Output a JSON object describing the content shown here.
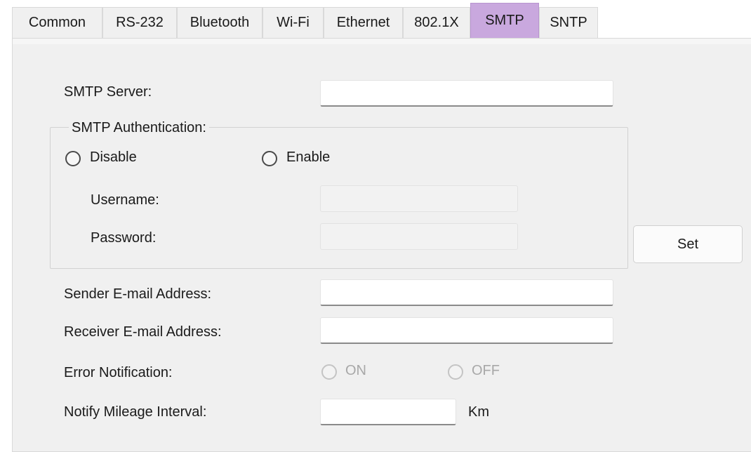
{
  "tabs": [
    "Common",
    "RS-232",
    "Bluetooth",
    "Wi-Fi",
    "Ethernet",
    "802.1X",
    "SMTP",
    "SNTP"
  ],
  "active_tab": "SMTP",
  "colors": {
    "active_tab": "#c9a8de",
    "panel_bg": "#f0f0f0",
    "disabled_text": "#a8a8a8"
  },
  "form": {
    "smtp_server": {
      "label": "SMTP Server:",
      "value": ""
    },
    "auth": {
      "title": "SMTP Authentication:",
      "disable_label": "Disable",
      "enable_label": "Enable",
      "selected": "none",
      "username": {
        "label": "Username:",
        "value": ""
      },
      "password": {
        "label": "Password:",
        "value": ""
      }
    },
    "sender": {
      "label": "Sender E-mail Address:",
      "value": ""
    },
    "receiver": {
      "label": "Receiver E-mail Address:",
      "value": ""
    },
    "error_notification": {
      "label": "Error Notification:",
      "on_label": "ON",
      "off_label": "OFF",
      "enabled": false
    },
    "mileage": {
      "label": "Notify Mileage Interval:",
      "value": "",
      "unit": "Km"
    }
  },
  "set_button": "Set"
}
